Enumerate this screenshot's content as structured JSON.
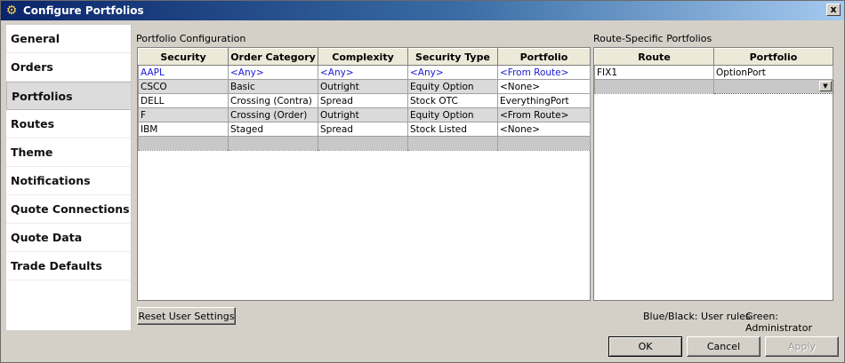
{
  "window": {
    "title": "Configure Portfolios",
    "icon": "gear-icon",
    "close": "x"
  },
  "sidebar": {
    "items": [
      {
        "label": "General"
      },
      {
        "label": "Orders"
      },
      {
        "label": "Portfolios",
        "active": true
      },
      {
        "label": "Routes"
      },
      {
        "label": "Theme"
      },
      {
        "label": "Notifications"
      },
      {
        "label": "Quote Connections"
      },
      {
        "label": "Quote Data"
      },
      {
        "label": "Trade Defaults"
      }
    ]
  },
  "portfolio_config": {
    "label": "Portfolio Configuration",
    "columns": [
      "Security",
      "Order Category",
      "Complexity",
      "Security Type",
      "Portfolio"
    ],
    "rows": [
      {
        "cells": [
          "AAPL",
          "<Any>",
          "<Any>",
          "<Any>",
          "<From Route>"
        ],
        "color": "#1a1ad8"
      },
      {
        "cells": [
          "CSCO",
          "Basic",
          "Outright",
          "Equity Option",
          "<None>"
        ]
      },
      {
        "cells": [
          "DELL",
          "Crossing (Contra)",
          "Spread",
          "Stock OTC",
          "EverythingPort"
        ]
      },
      {
        "cells": [
          "F",
          "Crossing (Order)",
          "Outright",
          "Equity Option",
          "<From Route>"
        ]
      },
      {
        "cells": [
          "IBM",
          "Staged",
          "Spread",
          "Stock Listed",
          "<None>"
        ]
      }
    ]
  },
  "route_portfolios": {
    "label": "Route-Specific Portfolios",
    "columns": [
      "Route",
      "Portfolio"
    ],
    "rows": [
      {
        "cells": [
          "FIX1",
          "OptionPort"
        ]
      }
    ],
    "dropdown_icon": "chevron-down-icon"
  },
  "footer": {
    "reset_label": "Reset User Settings",
    "legend_user": "Blue/Black: User rules",
    "legend_admin": "Green: Administrator"
  },
  "buttons": {
    "ok": "OK",
    "cancel": "Cancel",
    "apply": "Apply"
  },
  "colors": {
    "user_rule_blue": "#1a1ad8",
    "title_gradient_start": "#0a246a",
    "title_gradient_end": "#a6caf0"
  }
}
